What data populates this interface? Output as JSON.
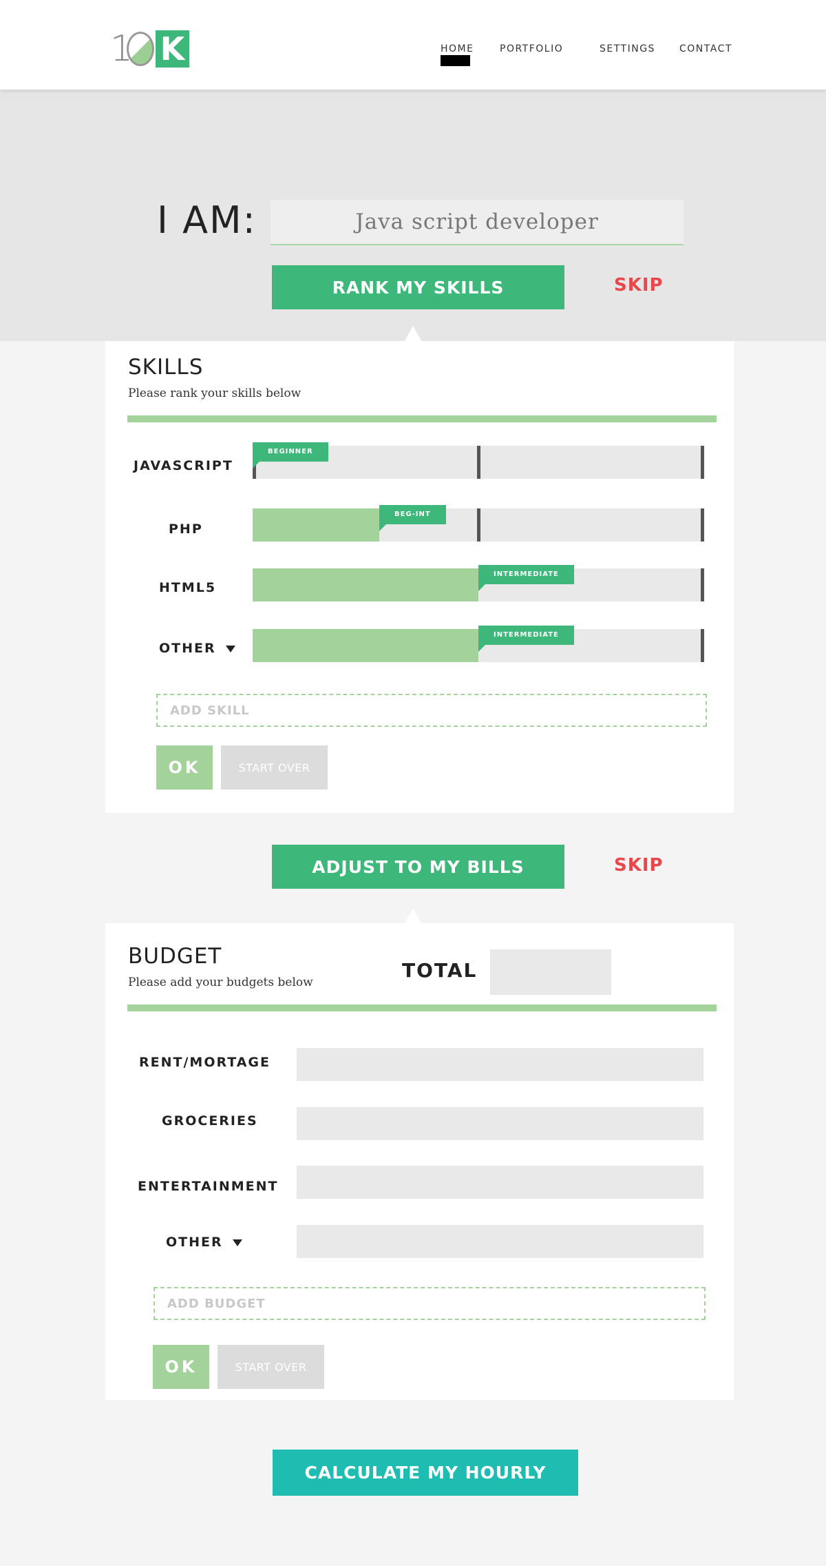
{
  "logo": {
    "text_one": "1",
    "text_k": "K"
  },
  "nav": [
    {
      "label": "HOME"
    },
    {
      "label": "PORTFOLIO"
    },
    {
      "label": "SETTINGS"
    },
    {
      "label": "CONTACT"
    }
  ],
  "hero": {
    "iam_label": "I AM:",
    "role_value": "Java script developer",
    "rank_button": "RANK MY SKILLS",
    "skip": "SKIP"
  },
  "skills": {
    "title": "SKILLS",
    "subtitle": "Please rank your skills below",
    "rows": [
      {
        "label": "JAVASCRIPT",
        "level": "BEGINNER",
        "fill_fraction": 0.0
      },
      {
        "label": "PHP",
        "level": "BEG-INT",
        "fill_fraction": 0.28
      },
      {
        "label": "HTML5",
        "level": "INTERMEDIATE",
        "fill_fraction": 0.5
      },
      {
        "label": "OTHER",
        "level": "INTERMEDIATE",
        "fill_fraction": 0.5
      }
    ],
    "add_placeholder": "ADD SKILL",
    "ok": "OK",
    "start_over": "START OVER"
  },
  "bills": {
    "adjust_button": "ADJUST TO MY BILLS",
    "skip": "SKIP"
  },
  "budget": {
    "title": "BUDGET",
    "subtitle": "Please add your budgets below",
    "total_label": "TOTAL",
    "rows": [
      {
        "label": "RENT/MORTAGE"
      },
      {
        "label": "GROCERIES"
      },
      {
        "label": "ENTERTAINMENT"
      },
      {
        "label": "OTHER"
      }
    ],
    "add_placeholder": "ADD BUDGET",
    "ok": "OK",
    "start_over": "START OVER"
  },
  "calculate_button": "CALCULATE MY HOURLY",
  "colors": {
    "accent_green": "#3db87a",
    "light_green": "#a3d39b",
    "skip_red": "#e8474b",
    "teal": "#1fbcb1"
  }
}
